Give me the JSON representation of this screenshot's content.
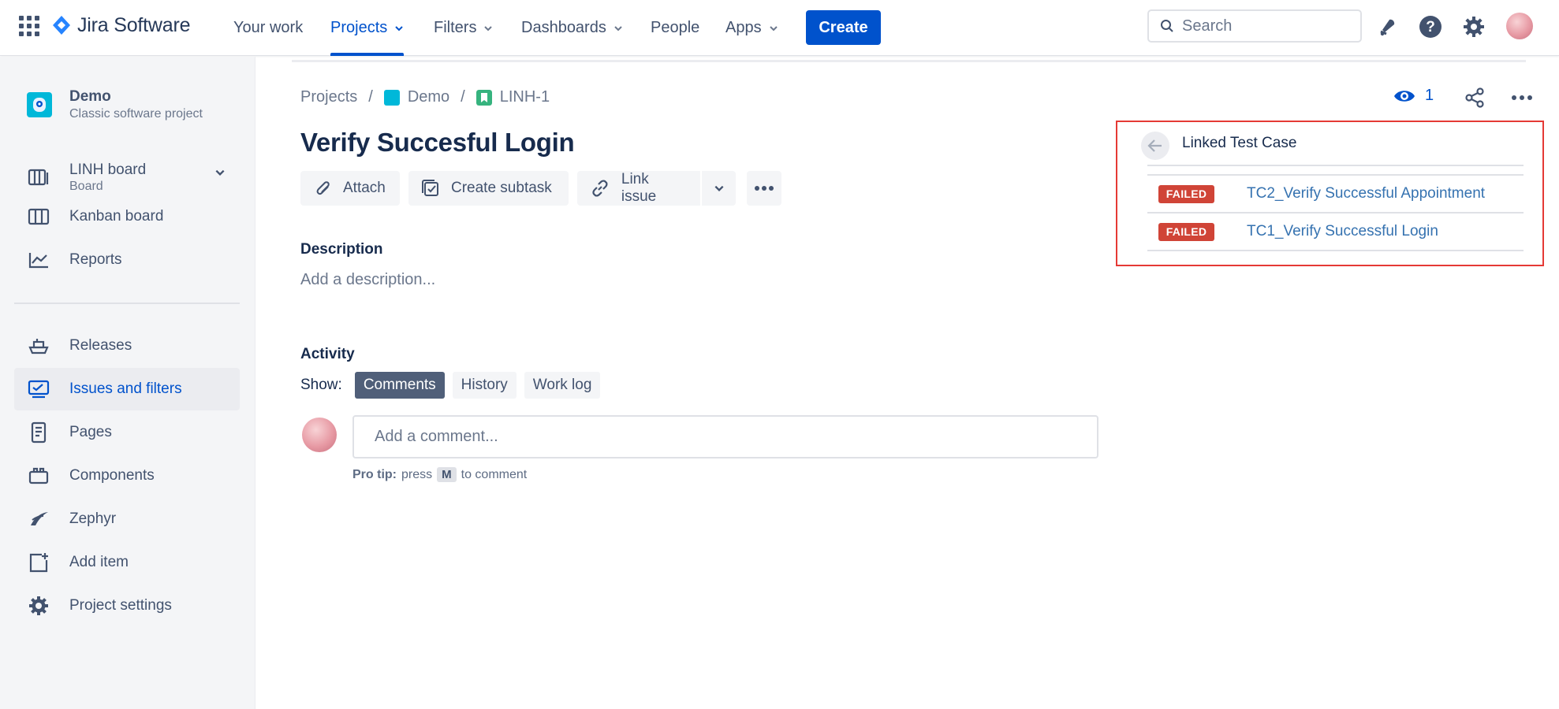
{
  "topnav": {
    "product": "Jira Software",
    "items": [
      {
        "label": "Your work"
      },
      {
        "label": "Projects"
      },
      {
        "label": "Filters"
      },
      {
        "label": "Dashboards"
      },
      {
        "label": "People"
      },
      {
        "label": "Apps"
      }
    ],
    "create_label": "Create",
    "search_placeholder": "Search",
    "accent": "#0052cc"
  },
  "sidebar": {
    "project_name": "Demo",
    "project_type": "Classic software project",
    "board_name": "LINH board",
    "board_sub": "Board",
    "items": [
      {
        "label": "Kanban board",
        "icon": "kanban-icon"
      },
      {
        "label": "Reports",
        "icon": "reports-icon"
      },
      {
        "label": "Releases",
        "icon": "releases-icon"
      },
      {
        "label": "Issues and filters",
        "icon": "issues-icon"
      },
      {
        "label": "Pages",
        "icon": "pages-icon"
      },
      {
        "label": "Components",
        "icon": "components-icon"
      },
      {
        "label": "Zephyr",
        "icon": "zephyr-icon"
      },
      {
        "label": "Add item",
        "icon": "add-item-icon"
      },
      {
        "label": "Project settings",
        "icon": "gear-icon"
      }
    ]
  },
  "issue": {
    "breadcrumb": {
      "projects": "Projects",
      "project": "Demo",
      "key": "LINH-1",
      "separator": "/"
    },
    "watchers": "1",
    "title": "Verify Succesful Login",
    "actions": {
      "attach": "Attach",
      "subtask": "Create subtask",
      "link": "Link issue"
    },
    "description_label": "Description",
    "description_placeholder": "Add a description...",
    "activity_label": "Activity",
    "show_label": "Show:",
    "tabs": [
      "Comments",
      "History",
      "Work log"
    ],
    "comment_placeholder": "Add a comment...",
    "protip_label": "Pro tip:",
    "protip_press": "press",
    "protip_key": "M",
    "protip_suffix": "to comment"
  },
  "linked_panel": {
    "title": "Linked Test Case",
    "border_color": "#e53935",
    "rows": [
      {
        "status": "FAILED",
        "name": "TC2_Verify Successful Appointment"
      },
      {
        "status": "FAILED",
        "name": "TC1_Verify Successful Login"
      }
    ]
  }
}
